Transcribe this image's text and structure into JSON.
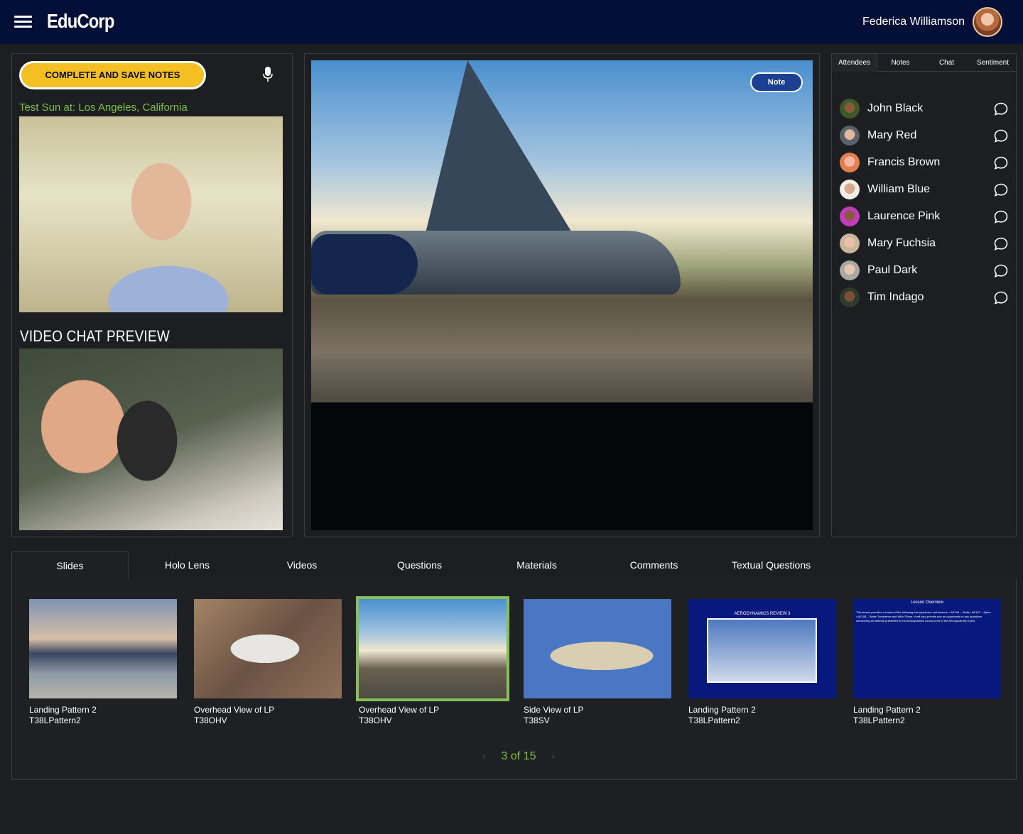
{
  "header": {
    "brand": "EduCorp",
    "user_name": "Federica Williamson"
  },
  "left": {
    "complete_button": "COMPLETE AND SAVE NOTES",
    "location": "Test Sun at: Los Angeles, California",
    "preview_title": "VIDEO CHAT PREVIEW"
  },
  "center": {
    "note_button": "Note"
  },
  "right": {
    "tabs": [
      "Attendees",
      "Notes",
      "Chat",
      "Sentiment"
    ],
    "active_tab": "Attendees",
    "attendees": [
      {
        "name": "John Black"
      },
      {
        "name": "Mary Red"
      },
      {
        "name": "Francis Brown"
      },
      {
        "name": "William Blue"
      },
      {
        "name": "Laurence Pink"
      },
      {
        "name": "Mary Fuchsia"
      },
      {
        "name": "Paul Dark"
      },
      {
        "name": "Tim Indago"
      }
    ]
  },
  "bottom": {
    "tabs": [
      "Slides",
      "Holo Lens",
      "Videos",
      "Questions",
      "Materials",
      "Comments",
      "Textual Questions"
    ],
    "active_tab": "Slides",
    "slides": [
      {
        "title": "Landing Pattern 2",
        "code": "T38LPattern2"
      },
      {
        "title": "Overhead View of LP",
        "code": "T38OHV"
      },
      {
        "title": "Overhead View of LP",
        "code": "T38OHV"
      },
      {
        "title": "Side View of LP",
        "code": "T38SV"
      },
      {
        "title": "Landing Pattern 2",
        "code": "T38LPattern2",
        "thumb_caption": "AERODYNAMICS REVIEW 3"
      },
      {
        "title": "Landing Pattern 2",
        "code": "T38LPattern2",
        "thumb_caption": "Lesson Overview",
        "thumb_text": "This lesson provides a review of the following Aerodynamics unit lessons: • AE106 – Stalls • AE107 – Spins • AE108 – Wake Turbulence and Wind Shear. It will also provide you an opportunity to ask questions concerning all material presented in the Aerodynamics course prior to the Aerodynamics Exam."
      }
    ],
    "pager": "3 of 15"
  },
  "colors": {
    "header_bg": "#030f36",
    "accent_yellow": "#f3bf23",
    "accent_green": "#7fc13b",
    "note_blue": "#1b3f91"
  }
}
